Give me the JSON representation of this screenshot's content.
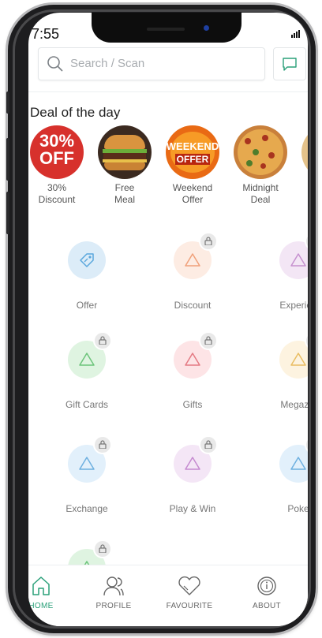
{
  "status_bar": {
    "time": "7:55"
  },
  "search": {
    "placeholder": "Search / Scan"
  },
  "deal_section": {
    "title": "Deal of the day",
    "items": [
      {
        "label": "30%\nDiscount",
        "badge_text_top": "30%",
        "badge_text_bottom": "OFF"
      },
      {
        "label": "Free\nMeal"
      },
      {
        "label": "Weekend\nOffer",
        "badge_text_top": "WEEKEND",
        "badge_text_bottom": "OFFER"
      },
      {
        "label": "Midnight\nDeal"
      }
    ]
  },
  "categories": [
    {
      "label": "Offer",
      "icon": "tag-icon",
      "color": "#dcecf8",
      "stroke": "#5aa7dd",
      "locked": false
    },
    {
      "label": "Discount",
      "icon": "triangle-icon",
      "color": "#fdece3",
      "stroke": "#f0a07a",
      "locked": true
    },
    {
      "label": "Experien",
      "icon": "triangle-icon",
      "color": "#f3e6f5",
      "stroke": "#c690cf",
      "locked": true
    },
    {
      "label": "Gift Cards",
      "icon": "triangle-icon",
      "color": "#dff4e1",
      "stroke": "#6cc47a",
      "locked": true
    },
    {
      "label": "Gifts",
      "icon": "triangle-icon",
      "color": "#fde4e6",
      "stroke": "#e47a83",
      "locked": true
    },
    {
      "label": "Megazin",
      "icon": "triangle-icon",
      "color": "#fdf3e0",
      "stroke": "#e9bd62",
      "locked": true
    },
    {
      "label": "Exchange",
      "icon": "triangle-icon",
      "color": "#e2f0fb",
      "stroke": "#6eb0e0",
      "locked": true
    },
    {
      "label": "Play & Win",
      "icon": "triangle-icon",
      "color": "#f4e6f6",
      "stroke": "#c58ad0",
      "locked": true
    },
    {
      "label": "Poke",
      "icon": "triangle-icon",
      "color": "#e2f0fb",
      "stroke": "#6eb0e0",
      "locked": true
    },
    {
      "label": "",
      "icon": "triangle-icon",
      "color": "#dff4e1",
      "stroke": "#6cc47a",
      "locked": true
    }
  ],
  "bottom_nav": [
    {
      "label": "HOME",
      "icon": "home-icon",
      "active": true
    },
    {
      "label": "PROFILE",
      "icon": "profile-icon",
      "active": false
    },
    {
      "label": "FAVOURITE",
      "icon": "heart-icon",
      "active": false
    },
    {
      "label": "ABOUT",
      "icon": "info-icon",
      "active": false
    }
  ],
  "colors": {
    "accent": "#2aa079",
    "deal_red": "#d7312c"
  }
}
